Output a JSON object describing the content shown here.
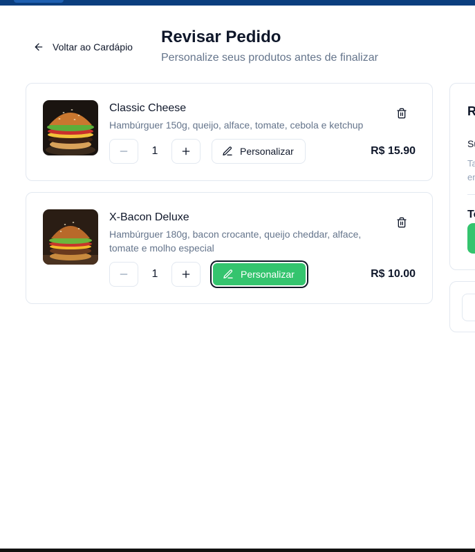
{
  "header": {
    "back_label": "Voltar ao Cardápio",
    "title": "Revisar Pedido",
    "subtitle": "Personalize seus produtos antes de finalizar"
  },
  "items": [
    {
      "name": "Classic Cheese",
      "description": "Hambúrguer 150g, queijo, alface, tomate, cebola e ketchup",
      "quantity": "1",
      "customize_label": "Personalizar",
      "price": "R$ 15.90",
      "image": "classic-cheese-burger-photo"
    },
    {
      "name": "X-Bacon Deluxe",
      "description": "Hambúrguer 180g, bacon crocante, queijo cheddar, alface, tomate e molho especial",
      "quantity": "1",
      "customize_label": "Personalizar",
      "price": "R$ 10.00",
      "image": "x-bacon-deluxe-burger-photo"
    }
  ],
  "summary": {
    "title": "R",
    "subtotal_label": "Su",
    "note": "Ta\nen",
    "total_label": "To"
  },
  "icons": {
    "back": "arrow-left-icon",
    "delete": "trash-icon",
    "decrease": "minus-icon",
    "increase": "plus-icon",
    "customize": "pencil-icon"
  },
  "colors": {
    "brand_topbar": "#0b3e7e",
    "accent_green": "#34c46e",
    "text_primary": "#0f172a",
    "text_muted": "#64748b",
    "border": "#e2e8f0"
  }
}
